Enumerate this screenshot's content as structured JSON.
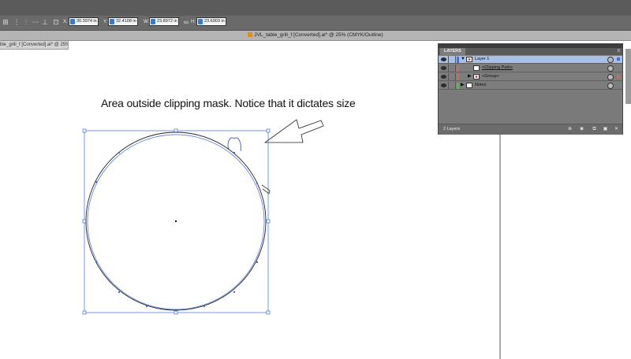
{
  "control_bar": {
    "x_label": "X:",
    "x_value": "30.3974 in",
    "y_label": "Y:",
    "y_value": "32.4108 in",
    "w_label": "W:",
    "w_value": "23.8972 in",
    "h_label": "H:",
    "h_value": "23.6903 in",
    "icons": [
      "transform-reference-icon",
      "link-proportions-icon"
    ]
  },
  "document": {
    "title": "JVL_table_grill_f [Converted].ai* @ 25% (CMYK/Outline)",
    "tab_label": "ble_grill_f [Converted].ai* @ 25% (CMYK/Outline)"
  },
  "annotation": {
    "text": "Area outside clipping mask.  Notice that it dictates size"
  },
  "layers_panel": {
    "tab": "LAYERS",
    "rows": [
      {
        "name": "Layer 1",
        "type": "layer",
        "swatch": "#4a6fd6",
        "selected": true
      },
      {
        "name": "<Clipping Path>",
        "type": "clipping-path",
        "swatch": "#c86b6b",
        "selected": false
      },
      {
        "name": "<Group>",
        "type": "group",
        "swatch": "#c86b6b",
        "selected": false
      },
      {
        "name": "Notes",
        "type": "layer",
        "swatch": "#4fc34f",
        "selected": false
      }
    ],
    "footer_count": "2 Layers"
  },
  "colors": {
    "selection_blue": "#3d6bd6",
    "panel_gray": "#7d7d7d",
    "selected_row": "#a8bfe8"
  }
}
